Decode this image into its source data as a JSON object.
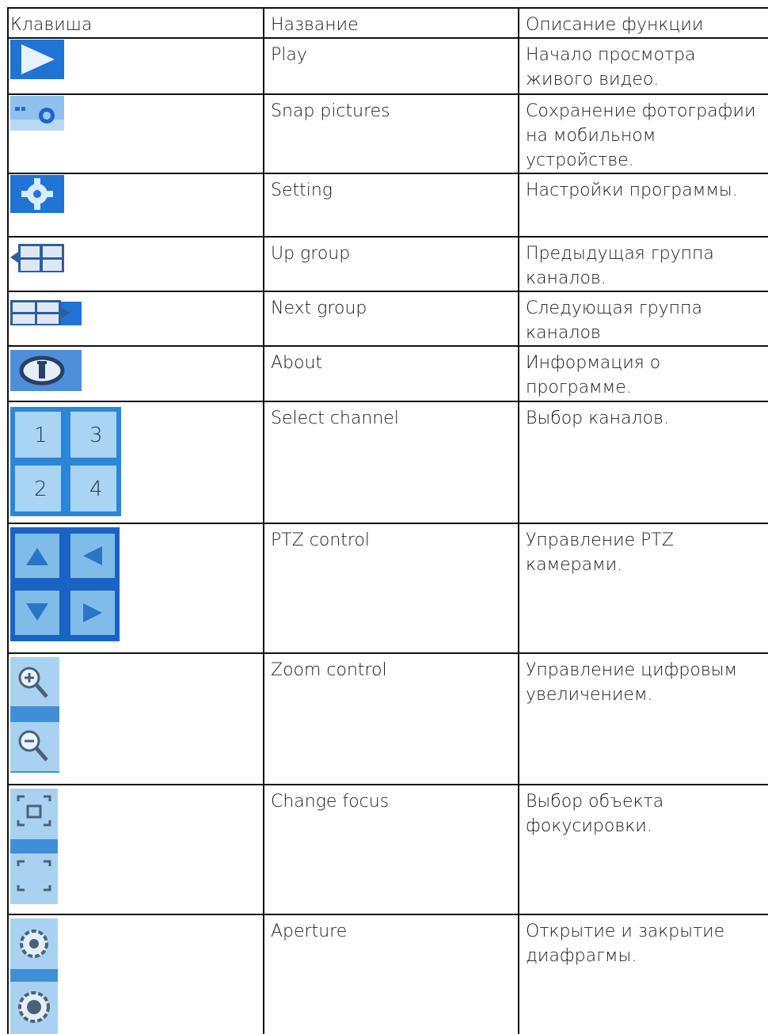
{
  "table": {
    "headers": [
      "Клавиша",
      "Название",
      "Описание функции"
    ],
    "rows": [
      {
        "icon": "play-icon",
        "name": "Play",
        "description": "Начало просмотра живого видео."
      },
      {
        "icon": "snap-camera-icon",
        "name": "Snap pictures",
        "description": "Сохранение фотографии на мобильном устройстве."
      },
      {
        "icon": "gear-icon",
        "name": "Setting",
        "description": "Настройки программы."
      },
      {
        "icon": "up-group-icon",
        "name": "Up group",
        "description": "Предыдущая группа каналов."
      },
      {
        "icon": "next-group-icon",
        "name": "Next group",
        "description": "Следующая группа каналов"
      },
      {
        "icon": "info-icon",
        "name": "About",
        "description": "Информация о программе."
      },
      {
        "icon": "channel-select-icon",
        "name": "Select channel",
        "description": "Выбор каналов.",
        "digits": [
          "1",
          "3",
          "2",
          "4"
        ]
      },
      {
        "icon": "ptz-arrows-icon",
        "name": "PTZ control",
        "description": "Управление PTZ камерами."
      },
      {
        "icon": "zoom-icon",
        "name": "Zoom control",
        "description": "Управление цифровым увеличением."
      },
      {
        "icon": "focus-icon",
        "name": "Change focus",
        "description": "Выбор объекта фокусировки."
      },
      {
        "icon": "aperture-icon",
        "name": "Aperture",
        "description": "Открытие и закрытие диафрагмы."
      }
    ]
  }
}
